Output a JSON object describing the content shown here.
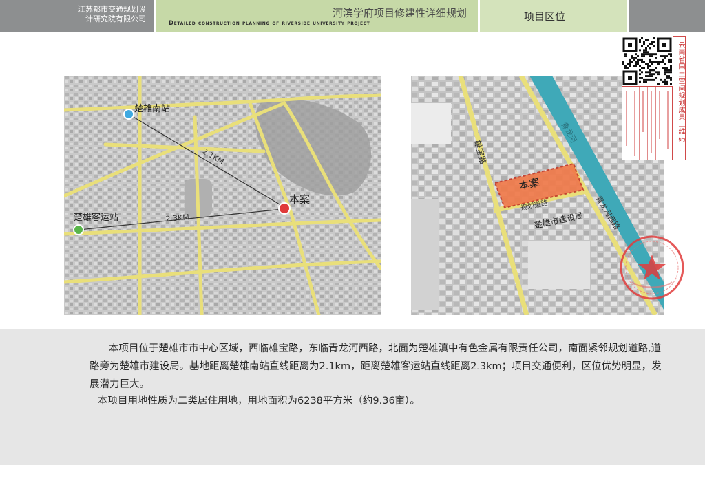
{
  "header": {
    "org_line1": "江苏都市交通规划设",
    "org_line2": "计研究院有限公司",
    "title_cn": "河滨学府项目修建性详细规划",
    "title_en": "Detailed construction planning of riverside university project",
    "section": "项目区位"
  },
  "map_left": {
    "labels": {
      "south_station": "楚雄南站",
      "bus_station": "楚雄客运站",
      "project": "本案",
      "dist_south": "2.1KM",
      "dist_bus": "2.3KM"
    },
    "colors": {
      "road": "#e9df7a",
      "blue_marker": "#3fa9e0",
      "green_marker": "#5ab54a",
      "red_marker": "#e03a3a"
    }
  },
  "map_right": {
    "labels": {
      "project": "本案",
      "xiongbao_road": "雄宝路",
      "qinglong_river": "青龙河",
      "qinglong_west_road": "青龙河西路",
      "planned_road": "规划道路",
      "construction_bureau": "楚雄市建设局"
    },
    "colors": {
      "road": "#e9df7a",
      "river": "#3fa9b8",
      "site": "#f07a4a"
    }
  },
  "qr": {
    "side_text": "云南省国土空间规划成果二维码"
  },
  "body": {
    "paragraph1": "本项目位于楚雄市市中心区域，西临雄宝路，东临青龙河西路，北面为楚雄滇中有色金属有限责任公司，南面紧邻规划道路,道路旁为楚雄市建设局。基地距离楚雄南站直线距离为2.1km，距离楚雄客运站直线距离2.3km；项目交通便利，区位优势明显，发展潜力巨大。",
    "paragraph2": "本项目用地性质为二类居住用地，用地面积为6238平方米（约9.36亩）。"
  }
}
